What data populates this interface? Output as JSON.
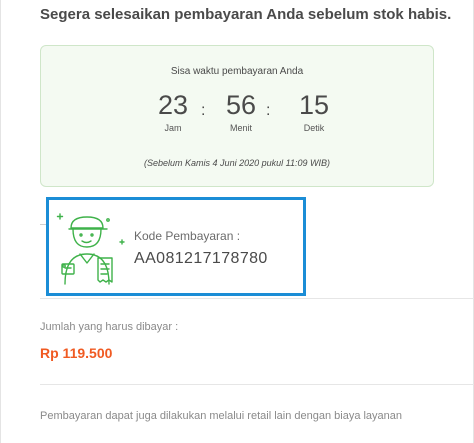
{
  "headline": "Segera selesaikan pembayaran Anda sebelum stok habis.",
  "timer": {
    "title": "Sisa waktu pembayaran Anda",
    "hours": "23",
    "hours_label": "Jam",
    "minutes": "56",
    "minutes_label": "Menit",
    "seconds": "15",
    "seconds_label": "Detik",
    "separator": ":",
    "deadline": "(Sebelum Kamis 4 Juni 2020 pukul 11:09 WIB)"
  },
  "payment_code": {
    "label": "Kode Pembayaran :",
    "value": "AA081217178780",
    "highlight_color": "#1b8dd6",
    "icon": "courier-receipt-icon"
  },
  "amount": {
    "label": "Jumlah yang harus dibayar :",
    "value": "Rp 119.500",
    "color": "#f05a22"
  },
  "note": "Pembayaran dapat juga dilakukan melalui retail lain dengan biaya layanan"
}
